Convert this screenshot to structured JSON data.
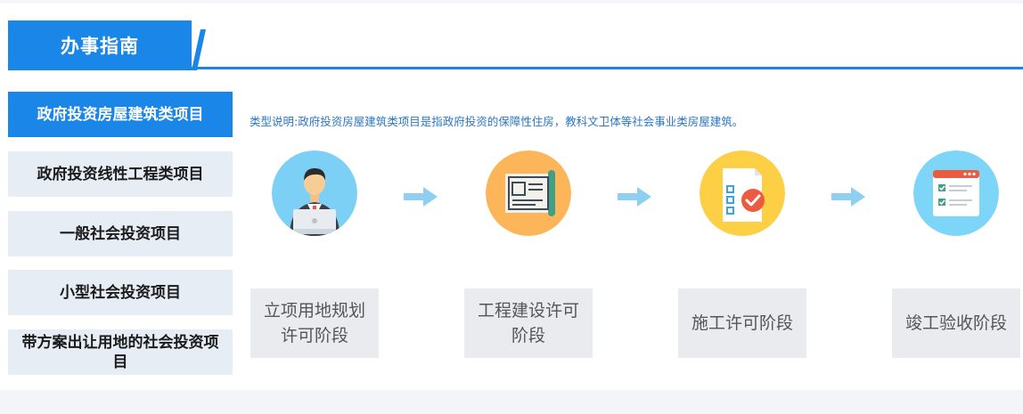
{
  "header": {
    "title": "办事指南"
  },
  "sidebar": {
    "items": [
      {
        "label": "政府投资房屋建筑类项目",
        "active": true
      },
      {
        "label": "政府投资线性工程类项目",
        "active": false
      },
      {
        "label": "一般社会投资项目",
        "active": false
      },
      {
        "label": "小型社会投资项目",
        "active": false
      },
      {
        "label": "带方案出让用地的社会投资项目",
        "active": false
      }
    ]
  },
  "main": {
    "description": "类型说明:政府投资房屋建筑类项目是指政府投资的保障性住房，教科文卫体等社会事业类房屋建筑。",
    "steps": [
      {
        "label": "立项用地规划许可阶段",
        "icon": "person-laptop-icon",
        "icon_bg": "#7dd0f5"
      },
      {
        "label": "工程建设许可阶段",
        "icon": "blueprint-icon",
        "icon_bg": "#fdb55a"
      },
      {
        "label": "施工许可阶段",
        "icon": "checklist-document-icon",
        "icon_bg": "#fdcf45"
      },
      {
        "label": "竣工验收阶段",
        "icon": "browser-checklist-icon",
        "icon_bg": "#7dd6f7"
      }
    ]
  },
  "colors": {
    "accent": "#1a86e8",
    "sidebar_bg": "#e6edf5",
    "step_box_bg": "#e9ebee",
    "arrow": "#8fd0f2"
  }
}
